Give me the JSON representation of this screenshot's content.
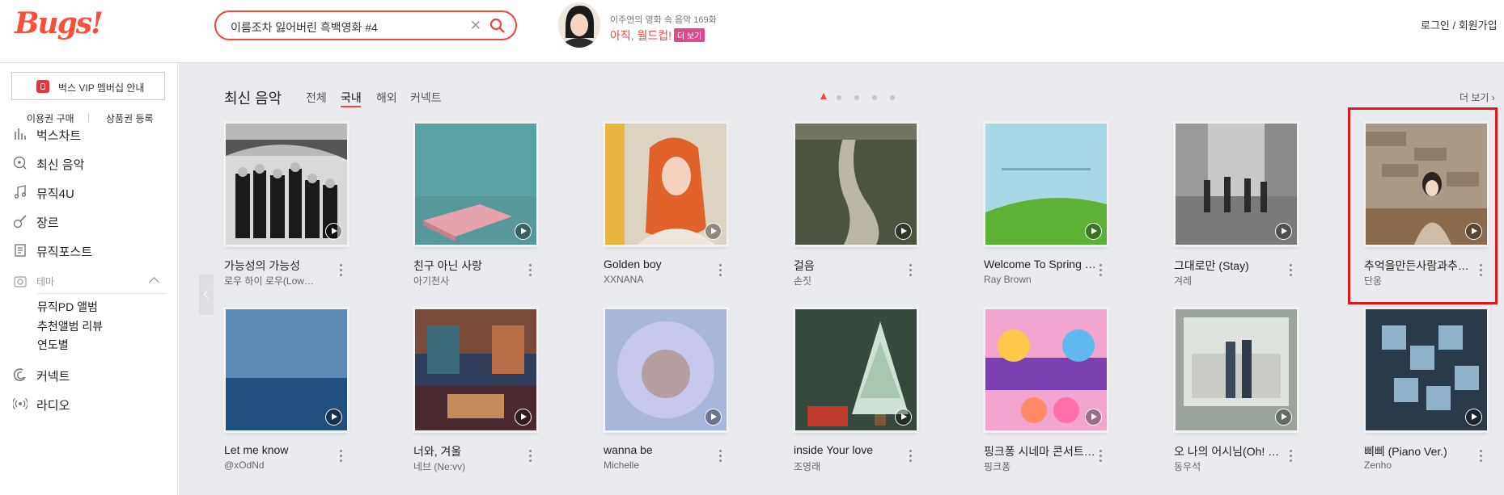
{
  "header": {
    "logo": "Bugs!",
    "search_value": "이름조차 잃어버린 흑백영화 #4",
    "promo_subtitle": "이주연의 영화 속 음악 169화",
    "promo_title": "아직, 월드컵!",
    "promo_more": "더 보기",
    "login": "로그인 / 회원가입"
  },
  "sidebar": {
    "vip_label": "벅스 VIP 멤버십 안내",
    "buy_pass": "이용권 구매",
    "register_gift": "상품권 등록",
    "nav": [
      "벅스차트",
      "최신 음악",
      "뮤직4U",
      "장르",
      "뮤직포스트"
    ],
    "theme_label": "테마",
    "theme_items": [
      "뮤직PD 앨범",
      "추천앨범 리뷰",
      "연도별"
    ],
    "nav_bottom": [
      "커넥트",
      "라디오"
    ]
  },
  "main": {
    "section_title": "최신 음악",
    "tabs": [
      "전체",
      "국내",
      "해외",
      "커넥트"
    ],
    "active_tab": "국내",
    "more": "더 보기",
    "albums": [
      {
        "title": "가능성의 가능성",
        "artist": "로우 하이 로우(Low…"
      },
      {
        "title": "친구 아닌 사랑",
        "artist": "아기천사"
      },
      {
        "title": "Golden boy",
        "artist": "XXNANA"
      },
      {
        "title": "걸음",
        "artist": "손짓"
      },
      {
        "title": "Welcome To Spring …",
        "artist": "Ray Brown"
      },
      {
        "title": "그대로만 (Stay)",
        "artist": "겨레"
      },
      {
        "title": "추억을만든사람과추억…",
        "artist": "단옹"
      },
      {
        "title": "Let me know",
        "artist": "@xOdNd"
      },
      {
        "title": "너와, 겨울",
        "artist": "네브 (Ne:vv)"
      },
      {
        "title": "wanna be",
        "artist": "Michelle"
      },
      {
        "title": "inside Your love",
        "artist": "조영래"
      },
      {
        "title": "핑크퐁 시네마 콘서트 …",
        "artist": "핑크퐁"
      },
      {
        "title": "오 나의 어시님(Oh! …",
        "artist": "동우석"
      },
      {
        "title": "삐삐 (Piano Ver.)",
        "artist": "Zenho"
      }
    ]
  },
  "colors": {
    "accent": "#f0453a",
    "main_bg": "#eaebee",
    "highlight": "#e4161d"
  },
  "icons": [
    "search-icon",
    "clear-icon",
    "chart-icon",
    "new-music-icon",
    "music-note-icon",
    "guitar-icon",
    "post-icon",
    "theme-icon",
    "connect-icon",
    "radio-icon",
    "play-icon",
    "more-vertical-icon"
  ]
}
